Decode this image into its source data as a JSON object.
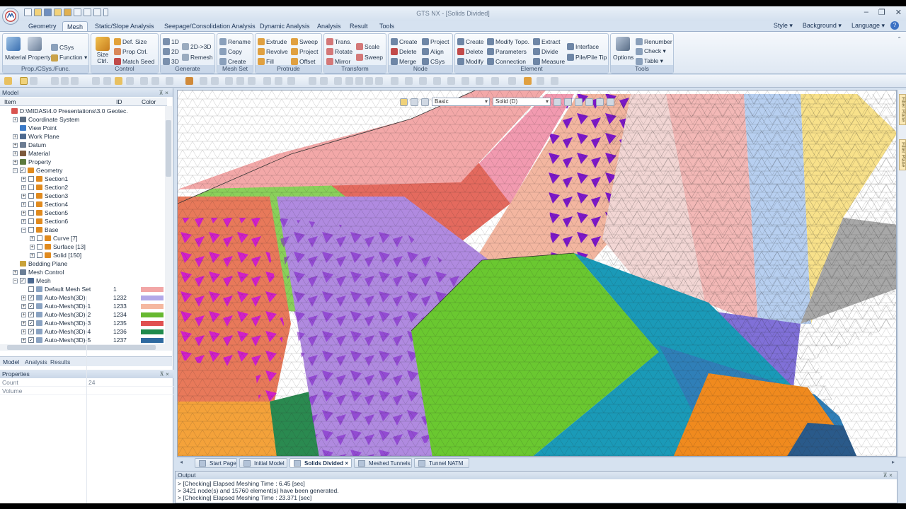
{
  "titlebar": {
    "title": "GTS NX - [Solids Divided]",
    "minimize": "–",
    "restore": "❐",
    "close": "✕"
  },
  "tabs": [
    {
      "label": "Geometry"
    },
    {
      "label": "Mesh"
    },
    {
      "label": "Static/Slope Analysis"
    },
    {
      "label": "Seepage/Consolidation Analysis"
    },
    {
      "label": "Dynamic Analysis"
    },
    {
      "label": "Analysis"
    },
    {
      "label": "Result"
    },
    {
      "label": "Tools"
    }
  ],
  "active_tab": "Mesh",
  "right_menu": {
    "style": "Style ▾",
    "background": "Background ▾",
    "language": "Language ▾",
    "help": "?"
  },
  "ribbon": {
    "prop": {
      "title": "Prop./CSys./Func.",
      "material_property": "Material Property",
      "csys": "CSys",
      "function": "Function ▾"
    },
    "control": {
      "title": "Control",
      "size_ctrl": "Size Ctrl.",
      "def_size": "Def. Size",
      "prop_ctrl": "Prop Ctrl.",
      "match_seed": "Match Seed"
    },
    "generate": {
      "title": "Generate",
      "d1": "1D",
      "d2": "2D",
      "d3": "3D",
      "d2to3": "2D->3D",
      "remesh": "Remesh"
    },
    "meshset": {
      "title": "Mesh Set",
      "rename": "Rename",
      "copy": "Copy",
      "create": "Create"
    },
    "protrude": {
      "title": "Protrude",
      "extrude": "Extrude",
      "revolve": "Revolve",
      "fill": "Fill",
      "sweep": "Sweep",
      "project": "Project",
      "offset": "Offset"
    },
    "transform": {
      "title": "Transform",
      "trans": "Trans.",
      "rotate": "Rotate",
      "mirror": "Mirror",
      "scale": "Scale",
      "sweep": "Sweep"
    },
    "node": {
      "title": "Node",
      "create": "Create",
      "delete": "Delete",
      "merge": "Merge",
      "project": "Project",
      "align": "Align",
      "csys": "CSys"
    },
    "element": {
      "title": "Element",
      "create": "Create",
      "delete": "Delete",
      "modify": "Modify",
      "modify_topo": "Modify Topo.",
      "parameters": "Parameters",
      "connection": "Connection",
      "extract": "Extract",
      "divide": "Divide",
      "measure": "Measure",
      "interface": "Interface",
      "pile": "Pile/Pile Tip"
    },
    "tools": {
      "title": "Tools",
      "options": "Options",
      "renumber": "Renumber",
      "check": "Check ▾",
      "table": "Table ▾"
    }
  },
  "model_panel": {
    "title": "Model",
    "col_item": "Item",
    "col_id": "ID",
    "col_color": "Color",
    "rows": [
      {
        "label": "D:\\MIDAS\\4.0 Presentations\\3.0 Geotec.",
        "indent": 0,
        "exp": "",
        "cb": "",
        "icon": "#d9534f",
        "id": "",
        "color": ""
      },
      {
        "label": "Coordinate System",
        "indent": 1,
        "exp": "+",
        "cb": "",
        "icon": "#5a6b80",
        "id": "",
        "color": ""
      },
      {
        "label": "View Point",
        "indent": 1,
        "exp": "",
        "cb": "",
        "icon": "#3a7ac8",
        "id": "",
        "color": ""
      },
      {
        "label": "Work Plane",
        "indent": 1,
        "exp": "+",
        "cb": "",
        "icon": "#4e6a8f",
        "id": "",
        "color": ""
      },
      {
        "label": "Datum",
        "indent": 1,
        "exp": "+",
        "cb": "",
        "icon": "#6b7c92",
        "id": "",
        "color": ""
      },
      {
        "label": "Material",
        "indent": 1,
        "exp": "+",
        "cb": "",
        "icon": "#7d5a3c",
        "id": "",
        "color": ""
      },
      {
        "label": "Property",
        "indent": 1,
        "exp": "+",
        "cb": "",
        "icon": "#5c7a3e",
        "id": "",
        "color": ""
      },
      {
        "label": "Geometry",
        "indent": 1,
        "exp": "−",
        "cb": "✓",
        "icon": "#e08a1e",
        "id": "",
        "color": ""
      },
      {
        "label": "Section1",
        "indent": 2,
        "exp": "+",
        "cb": "",
        "icon": "#e08a1e",
        "id": "",
        "color": ""
      },
      {
        "label": "Section2",
        "indent": 2,
        "exp": "+",
        "cb": "",
        "icon": "#e08a1e",
        "id": "",
        "color": ""
      },
      {
        "label": "Section3",
        "indent": 2,
        "exp": "+",
        "cb": "",
        "icon": "#e08a1e",
        "id": "",
        "color": ""
      },
      {
        "label": "Section4",
        "indent": 2,
        "exp": "+",
        "cb": "",
        "icon": "#e08a1e",
        "id": "",
        "color": ""
      },
      {
        "label": "Section5",
        "indent": 2,
        "exp": "+",
        "cb": "",
        "icon": "#e08a1e",
        "id": "",
        "color": ""
      },
      {
        "label": "Section6",
        "indent": 2,
        "exp": "+",
        "cb": "",
        "icon": "#e08a1e",
        "id": "",
        "color": ""
      },
      {
        "label": "Base",
        "indent": 2,
        "exp": "−",
        "cb": "",
        "icon": "#e08a1e",
        "id": "",
        "color": ""
      },
      {
        "label": "Curve [7]",
        "indent": 3,
        "exp": "+",
        "cb": "",
        "icon": "#e08a1e",
        "id": "",
        "color": ""
      },
      {
        "label": "Surface [13]",
        "indent": 3,
        "exp": "+",
        "cb": "",
        "icon": "#e08a1e",
        "id": "",
        "color": ""
      },
      {
        "label": "Solid [150]",
        "indent": 3,
        "exp": "+",
        "cb": "",
        "icon": "#e08a1e",
        "id": "",
        "color": ""
      },
      {
        "label": "Bedding Plane",
        "indent": 1,
        "exp": "",
        "cb": "",
        "icon": "#c9a23a",
        "id": "",
        "color": ""
      },
      {
        "label": "Mesh Control",
        "indent": 1,
        "exp": "+",
        "cb": "",
        "icon": "#6c7f96",
        "id": "",
        "color": ""
      },
      {
        "label": "Mesh",
        "indent": 1,
        "exp": "−",
        "cb": "✓",
        "icon": "#4d6a91",
        "id": "",
        "color": ""
      },
      {
        "label": "Default Mesh Set",
        "indent": 2,
        "exp": "",
        "cb": " ",
        "icon": "#8aa3c2",
        "id": "1",
        "color": "#f2a6a6"
      },
      {
        "label": "Auto-Mesh(3D)",
        "indent": 2,
        "exp": "+",
        "cb": "✓",
        "icon": "#8aa3c2",
        "id": "1232",
        "color": "#b2a8e8"
      },
      {
        "label": "Auto-Mesh(3D)-1",
        "indent": 2,
        "exp": "+",
        "cb": "✓",
        "icon": "#8aa3c2",
        "id": "1233",
        "color": "#f5b8a0"
      },
      {
        "label": "Auto-Mesh(3D)-2",
        "indent": 2,
        "exp": "+",
        "cb": "✓",
        "icon": "#8aa3c2",
        "id": "1234",
        "color": "#66b830"
      },
      {
        "label": "Auto-Mesh(3D)-3",
        "indent": 2,
        "exp": "+",
        "cb": "✓",
        "icon": "#8aa3c2",
        "id": "1235",
        "color": "#e05050"
      },
      {
        "label": "Auto-Mesh(3D)-4",
        "indent": 2,
        "exp": "+",
        "cb": "✓",
        "icon": "#8aa3c2",
        "id": "1236",
        "color": "#1f8a4c"
      },
      {
        "label": "Auto-Mesh(3D)-5",
        "indent": 2,
        "exp": "+",
        "cb": "✓",
        "icon": "#8aa3c2",
        "id": "1237",
        "color": "#2f6aa0"
      }
    ]
  },
  "left_tabs": {
    "model": "Model",
    "analysis": "Analysis",
    "results": "Results"
  },
  "properties": {
    "title": "Properties",
    "rows": [
      {
        "key": "Count",
        "value": "24"
      },
      {
        "key": "Volume",
        "value": ""
      }
    ]
  },
  "viewport": {
    "view_select": "Basic",
    "display_select": "Solid (D)",
    "right_tab_1": "Filter Plane",
    "right_tab_2": "Filter Plane"
  },
  "doc_tabs": [
    {
      "label": "Start Page",
      "active": false
    },
    {
      "label": "Initial Model",
      "active": false
    },
    {
      "label": "Solids Divided",
      "active": true
    },
    {
      "label": "Meshed Tunnels",
      "active": false
    },
    {
      "label": "Tunnel NATM",
      "active": false
    }
  ],
  "output": {
    "title": "Output",
    "lines": [
      "> [Checking] Elapsed Meshing Time : 6.45 [sec]",
      "> 3421 node(s) and 15760 element(s) have been generated.",
      "> [Checking] Elapsed Meshing Time : 23.371 [sec]"
    ]
  }
}
